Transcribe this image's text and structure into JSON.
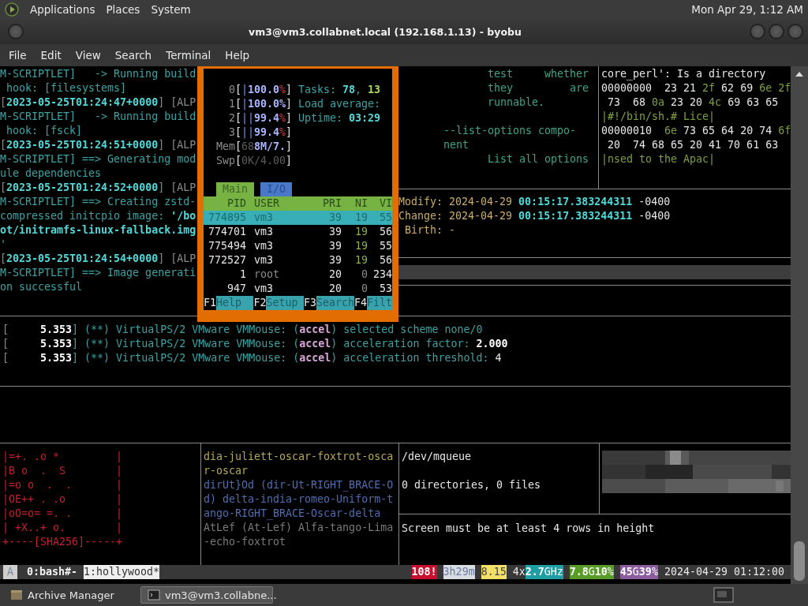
{
  "top_panel": {
    "menus": [
      "Applications",
      "Places",
      "System"
    ],
    "clock": "Mon Apr 29, 1:12 AM"
  },
  "window": {
    "title": "vm3@vm3.collabnet.local (192.168.1.13) - byobu"
  },
  "menu_bar": [
    "File",
    "Edit",
    "View",
    "Search",
    "Terminal",
    "Help"
  ],
  "build_log": [
    {
      "segments": [
        {
          "text": "M-SCRIPTLET]   -> Running build",
          "kind": "text"
        }
      ]
    },
    {
      "segments": [
        {
          "text": " hook: [filesystems]",
          "kind": "text"
        }
      ]
    },
    {
      "segments": [
        {
          "text": "[",
          "kind": "bracket"
        },
        {
          "text": "2023-05-25T01:24:47+0000",
          "kind": "strong"
        },
        {
          "text": "] [ALP",
          "kind": "bracket"
        }
      ]
    },
    {
      "segments": [
        {
          "text": "M-SCRIPTLET]   -> Running build",
          "kind": "text"
        }
      ]
    },
    {
      "segments": [
        {
          "text": " hook: [fsck]",
          "kind": "text"
        }
      ]
    },
    {
      "segments": [
        {
          "text": "[",
          "kind": "bracket"
        },
        {
          "text": "2023-05-25T01:24:51+0000",
          "kind": "strong"
        },
        {
          "text": "] [ALP",
          "kind": "bracket"
        }
      ]
    },
    {
      "segments": [
        {
          "text": "M-SCRIPTLET] ==> Generating mod",
          "kind": "text"
        }
      ]
    },
    {
      "segments": [
        {
          "text": "ule dependencies",
          "kind": "text"
        }
      ]
    },
    {
      "segments": [
        {
          "text": "[",
          "kind": "bracket"
        },
        {
          "text": "2023-05-25T01:24:52+0000",
          "kind": "strong"
        },
        {
          "text": "] [ALP",
          "kind": "bracket"
        }
      ]
    },
    {
      "segments": [
        {
          "text": "M-SCRIPTLET] ==> Creating zstd-",
          "kind": "text"
        }
      ]
    },
    {
      "segments": [
        {
          "text": "compressed initcpio image: ",
          "kind": "text"
        },
        {
          "text": "'/bo",
          "kind": "strong"
        }
      ]
    },
    {
      "segments": [
        {
          "text": "ot/initramfs-linux-fallback.img",
          "kind": "strong"
        }
      ]
    },
    {
      "segments": [
        {
          "text": "'",
          "kind": "text"
        }
      ]
    },
    {
      "segments": [
        {
          "text": "[",
          "kind": "bracket"
        },
        {
          "text": "2023-05-25T01:24:54+0000",
          "kind": "strong"
        },
        {
          "text": "] [ALP",
          "kind": "bracket"
        }
      ]
    },
    {
      "segments": [
        {
          "text": "M-SCRIPTLET] ==> Image generati",
          "kind": "text"
        }
      ]
    },
    {
      "segments": [
        {
          "text": "on successful",
          "kind": "text"
        }
      ]
    }
  ],
  "htop": {
    "meters": [
      {
        "left": [
          {
            "text": "0",
            "kind": "muted"
          },
          {
            "text": "[",
            "kind": "ink"
          },
          {
            "text": "|",
            "kind": "bar"
          },
          {
            "text": "100.0",
            "kind": "num"
          },
          {
            "text": "%",
            "kind": "warn"
          },
          {
            "text": "]",
            "kind": "ink"
          }
        ],
        "right": [
          {
            "text": "Tasks: ",
            "kind": "text"
          },
          {
            "text": "78",
            "kind": "strong"
          },
          {
            "text": ", ",
            "kind": "text"
          },
          {
            "text": "13",
            "kind": "run"
          }
        ]
      },
      {
        "left": [
          {
            "text": "1",
            "kind": "muted"
          },
          {
            "text": "[",
            "kind": "ink"
          },
          {
            "text": "|",
            "kind": "bar"
          },
          {
            "text": "100.0%",
            "kind": "num"
          },
          {
            "text": "]",
            "kind": "ink"
          }
        ],
        "right": [
          {
            "text": "Load average:",
            "kind": "text"
          }
        ]
      },
      {
        "left": [
          {
            "text": "2",
            "kind": "muted"
          },
          {
            "text": "[",
            "kind": "ink"
          },
          {
            "text": "||",
            "kind": "bar"
          },
          {
            "text": "99.4",
            "kind": "num"
          },
          {
            "text": "%",
            "kind": "warn"
          },
          {
            "text": "]",
            "kind": "ink"
          }
        ],
        "right": [
          {
            "text": "Uptime: ",
            "kind": "text"
          },
          {
            "text": "03:29",
            "kind": "strong"
          }
        ]
      },
      {
        "left": [
          {
            "text": "3",
            "kind": "muted"
          },
          {
            "text": "[",
            "kind": "ink"
          },
          {
            "text": "||",
            "kind": "bar"
          },
          {
            "text": "99.4",
            "kind": "num"
          },
          {
            "text": "%",
            "kind": "warn"
          },
          {
            "text": "]",
            "kind": "ink"
          }
        ]
      },
      {
        "left": [
          {
            "text": "Mem",
            "kind": "muted"
          },
          {
            "text": "[",
            "kind": "ink"
          },
          {
            "text": "68",
            "kind": "faint"
          },
          {
            "text": "8M/7.",
            "kind": "num"
          },
          {
            "text": "]",
            "kind": "ink"
          }
        ]
      },
      {
        "left": [
          {
            "text": "Swp",
            "kind": "muted"
          },
          {
            "text": "[",
            "kind": "ink"
          },
          {
            "text": "0K/4.00",
            "kind": "faint"
          },
          {
            "text": "]",
            "kind": "ink"
          }
        ]
      }
    ],
    "tabs": [
      {
        "label": "Main",
        "selected": true
      },
      {
        "label": "I/O",
        "selected": false
      }
    ],
    "columns": [
      "PID",
      "USER",
      "PRI",
      "NI",
      "VI"
    ],
    "processes": [
      {
        "pid": "774895",
        "user": "vm3",
        "pri": "39",
        "ni": "19",
        "vi": "55",
        "selected": true,
        "niced": true,
        "kind": "normal"
      },
      {
        "pid": "774701",
        "user": "vm3",
        "pri": "39",
        "ni": "19",
        "vi": "56",
        "selected": false,
        "niced": true,
        "kind": "normal"
      },
      {
        "pid": "775494",
        "user": "vm3",
        "pri": "39",
        "ni": "19",
        "vi": "55",
        "selected": false,
        "niced": true,
        "kind": "normal"
      },
      {
        "pid": "772527",
        "user": "vm3",
        "pri": "39",
        "ni": "19",
        "vi": "56",
        "selected": false,
        "niced": true,
        "kind": "normal"
      },
      {
        "pid": "1",
        "user": "root",
        "pri": "20",
        "ni": "0",
        "vi": "234",
        "selected": false,
        "niced": false,
        "kind": "system"
      },
      {
        "pid": "947",
        "user": "vm3",
        "pri": "20",
        "ni": "0",
        "vi": "53",
        "selected": false,
        "niced": false,
        "kind": "normal"
      }
    ],
    "function_keys": [
      {
        "key": "F1",
        "label": "Help"
      },
      {
        "key": "F2",
        "label": "Setup"
      },
      {
        "key": "F3",
        "label": "Search"
      },
      {
        "key": "F4",
        "label": "Filt"
      }
    ]
  },
  "man_page": {
    "paragraphs": [
      [
        {
          "text": "test     whether",
          "kind": "body"
        },
        {
          "text": "they         are",
          "kind": "body"
        },
        {
          "text": "runnable.",
          "kind": "body"
        }
      ],
      [
        {
          "text": "--list-options compo-",
          "kind": "option"
        },
        {
          "text": "nent",
          "kind": "option"
        },
        {
          "text": "List all options",
          "kind": "body"
        }
      ]
    ]
  },
  "hex_dump": [
    {
      "segments": [
        {
          "text": "core_perl': Is a directory",
          "kind": "ink"
        }
      ]
    },
    {
      "segments": [
        {
          "text": "00000000  23 21 ",
          "kind": "ink"
        },
        {
          "text": "2f",
          "kind": "hex"
        },
        {
          "text": " 62 69 ",
          "kind": "ink"
        },
        {
          "text": "6e 2f",
          "kind": "hex"
        }
      ]
    },
    {
      "segments": [
        {
          "text": " 73  68 ",
          "kind": "ink"
        },
        {
          "text": "0a",
          "kind": "hex"
        },
        {
          "text": " 23 20 ",
          "kind": "ink"
        },
        {
          "text": "4c",
          "kind": "hex"
        },
        {
          "text": " 69 63 65",
          "kind": "ink"
        }
      ]
    },
    {
      "segments": [
        {
          "text": "|#!/bin/sh.# Lice|",
          "kind": "hex"
        }
      ]
    },
    {
      "segments": [
        {
          "text": "00000010  ",
          "kind": "ink"
        },
        {
          "text": "6e",
          "kind": "hex"
        },
        {
          "text": " 73 65 64 20 74 ",
          "kind": "ink"
        },
        {
          "text": "6f",
          "kind": "hex"
        }
      ]
    },
    {
      "segments": [
        {
          "text": " 20  74 68 65 20 41 70 61 63",
          "kind": "ink"
        }
      ]
    },
    {
      "segments": [
        {
          "text": "|nsed to the Apac|",
          "kind": "hex"
        }
      ]
    }
  ],
  "file_stat": [
    {
      "segments": [
        {
          "text": "Modify: 2024-04-29 ",
          "kind": "label"
        },
        {
          "text": "00:15:17.383244311",
          "kind": "strong"
        },
        {
          "text": " -0400",
          "kind": "ink"
        }
      ]
    },
    {
      "segments": [
        {
          "text": "Change: 2024-04-29 ",
          "kind": "label"
        },
        {
          "text": "00:15:17.383244311",
          "kind": "strong"
        },
        {
          "text": " -0400",
          "kind": "ink"
        }
      ]
    },
    {
      "segments": [
        {
          "text": " Birth: -",
          "kind": "label"
        }
      ]
    }
  ],
  "kernel_log": [
    {
      "segments": [
        {
          "text": "[",
          "kind": "bracket"
        },
        {
          "text": "     5.353",
          "kind": "inkbold"
        },
        {
          "text": "] (**) VirtualPS/2 VMware VMMouse: (",
          "kind": "text"
        },
        {
          "text": "accel",
          "kind": "accent"
        },
        {
          "text": ") selected scheme none/0",
          "kind": "text"
        }
      ]
    },
    {
      "segments": [
        {
          "text": "[",
          "kind": "bracket"
        },
        {
          "text": "     5.353",
          "kind": "inkbold"
        },
        {
          "text": "] (**) VirtualPS/2 VMware VMMouse: (",
          "kind": "text"
        },
        {
          "text": "accel",
          "kind": "accent"
        },
        {
          "text": ") acceleration factor: ",
          "kind": "text"
        },
        {
          "text": "2.000",
          "kind": "inkbold"
        }
      ]
    },
    {
      "segments": [
        {
          "text": "[",
          "kind": "bracket"
        },
        {
          "text": "     5.353",
          "kind": "inkbold"
        },
        {
          "text": "] (**) VirtualPS/2 VMware VMMouse: (",
          "kind": "text"
        },
        {
          "text": "accel",
          "kind": "accent"
        },
        {
          "text": ") acceleration threshold: ",
          "kind": "text"
        },
        {
          "text": "4",
          "kind": "ink"
        }
      ]
    }
  ],
  "key_art": [
    "|=+. .o *         |",
    "|B o  .  S        |",
    "|=o o  .  .       |",
    "|OE++ . .o        |",
    "|oO=o= =. .       |",
    "| +X..+ o.        |",
    "+----[SHA256]-----+"
  ],
  "word_list": [
    {
      "segments": [
        {
          "text": "dia-juliett-oscar-foxtrot-osca",
          "kind": "word"
        }
      ]
    },
    {
      "segments": [
        {
          "text": "r-oscar",
          "kind": "word"
        }
      ]
    },
    {
      "segments": [
        {
          "text": "dirUt}Od (dir-Ut-RIGHT_BRACE-O",
          "kind": "entry"
        }
      ]
    },
    {
      "segments": [
        {
          "text": "d) delta-india-romeo-Uniform-t",
          "kind": "entry"
        }
      ]
    },
    {
      "segments": [
        {
          "text": "ango-RIGHT_BRACE-Oscar-delta",
          "kind": "entry"
        }
      ]
    },
    {
      "segments": [
        {
          "text": "AtLef (At-Lef) Alfa-tango-Lima",
          "kind": "other"
        }
      ]
    },
    {
      "segments": [
        {
          "text": "-echo-foxtrot",
          "kind": "other"
        }
      ]
    }
  ],
  "tree": {
    "path": "/dev/mqueue",
    "summary": "0 directories, 0 files"
  },
  "image_pane": {
    "kind": "picture"
  },
  "screen_message": "Screen must be at least 4 rows in height",
  "status_bar": {
    "mode": "A",
    "windows": [
      {
        "label": "0:bash#-",
        "selected": false
      },
      {
        "label": "1:hollywood*",
        "selected": true
      }
    ],
    "items": [
      {
        "text": "**108!**",
        "kind": "alert"
      },
      {
        "text": "3h29m",
        "kind": "uptime"
      },
      {
        "text": "8.15",
        "kind": "load"
      },
      {
        "text": "4x",
        "kind": "plain"
      },
      {
        "text": "**2.7**GHz",
        "kind": "cpu"
      },
      {
        "text": "**7.8**G**10**%",
        "kind": "mem"
      },
      {
        "text": "**45**G**39**%",
        "kind": "disk"
      },
      {
        "text": "2024-04-29 01:12:00",
        "kind": "clock"
      }
    ]
  },
  "taskbar": [
    {
      "label": "Archive Manager",
      "selected": false
    },
    {
      "label": "vm3@vm3.collabne...",
      "selected": true
    }
  ]
}
